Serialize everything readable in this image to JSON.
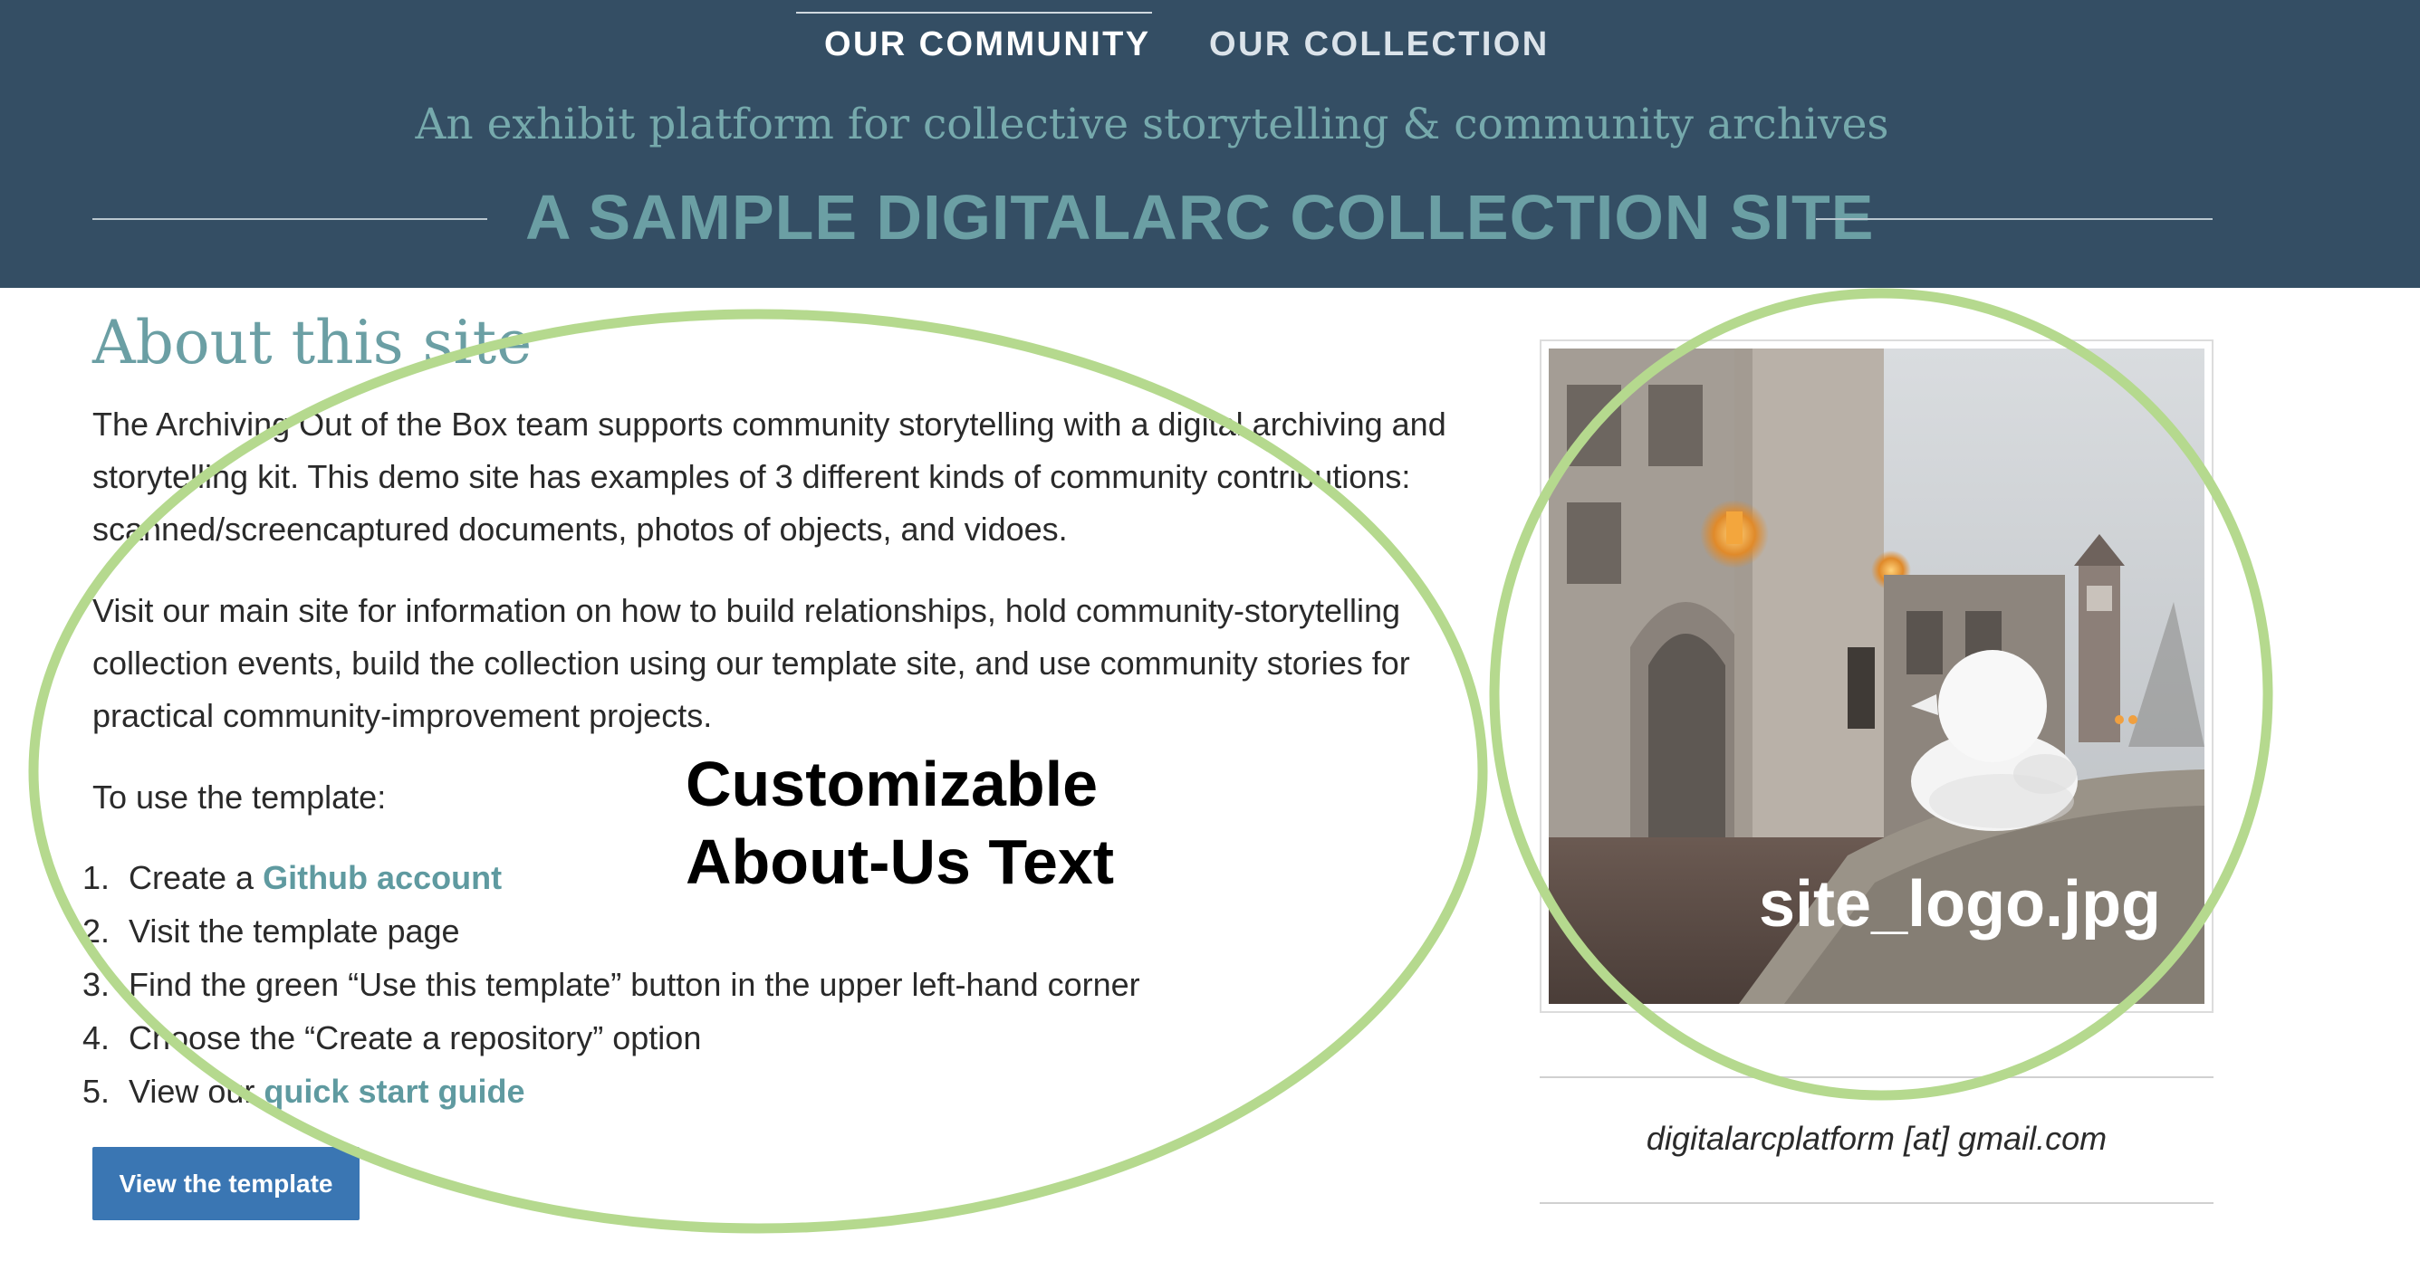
{
  "header": {
    "nav": [
      {
        "label": "OUR COMMUNITY",
        "active": true
      },
      {
        "label": "OUR COLLECTION",
        "active": false
      }
    ],
    "tagline": "An exhibit platform for collective storytelling & community archives",
    "site_title": "A SAMPLE DIGITALARC COLLECTION SITE",
    "background_color": "#344e64",
    "accent_color": "#6b9fa4"
  },
  "about": {
    "heading": "About this site",
    "paragraphs": [
      "The Archiving Out of the Box team supports community storytelling with a digital archiving and storytelling kit. This demo site has examples of 3 different kinds of community contributions: scanned/screencaptured documents, photos of objects, and vidoes.",
      "Visit our main site for information on how to build relationships, hold community-storytelling collection events, build the collection using our template site, and use community stories for practical community-improvement projects.",
      "To use the template:"
    ],
    "steps": [
      {
        "num": "1.",
        "text": "Create a ",
        "link": "Github account"
      },
      {
        "num": "2.",
        "text": "Visit the template page",
        "link": ""
      },
      {
        "num": "3.",
        "text": "Find the green “Use this template” button in the upper left-hand corner",
        "link": ""
      },
      {
        "num": "4.",
        "text": "Choose the “Create a repository” option",
        "link": ""
      },
      {
        "num": "5.",
        "text": "View our ",
        "link": "quick start guide"
      }
    ],
    "button_label": "View the template",
    "button_color": "#3a76b3"
  },
  "annotations": {
    "about_label": "Customizable About-Us Text",
    "logo_label": "site_logo.jpg",
    "circle_color": "#b5d98e"
  },
  "sidebar": {
    "logo_alt": "site_logo.jpg",
    "email": "digitalarcplatform [at] gmail.com"
  }
}
